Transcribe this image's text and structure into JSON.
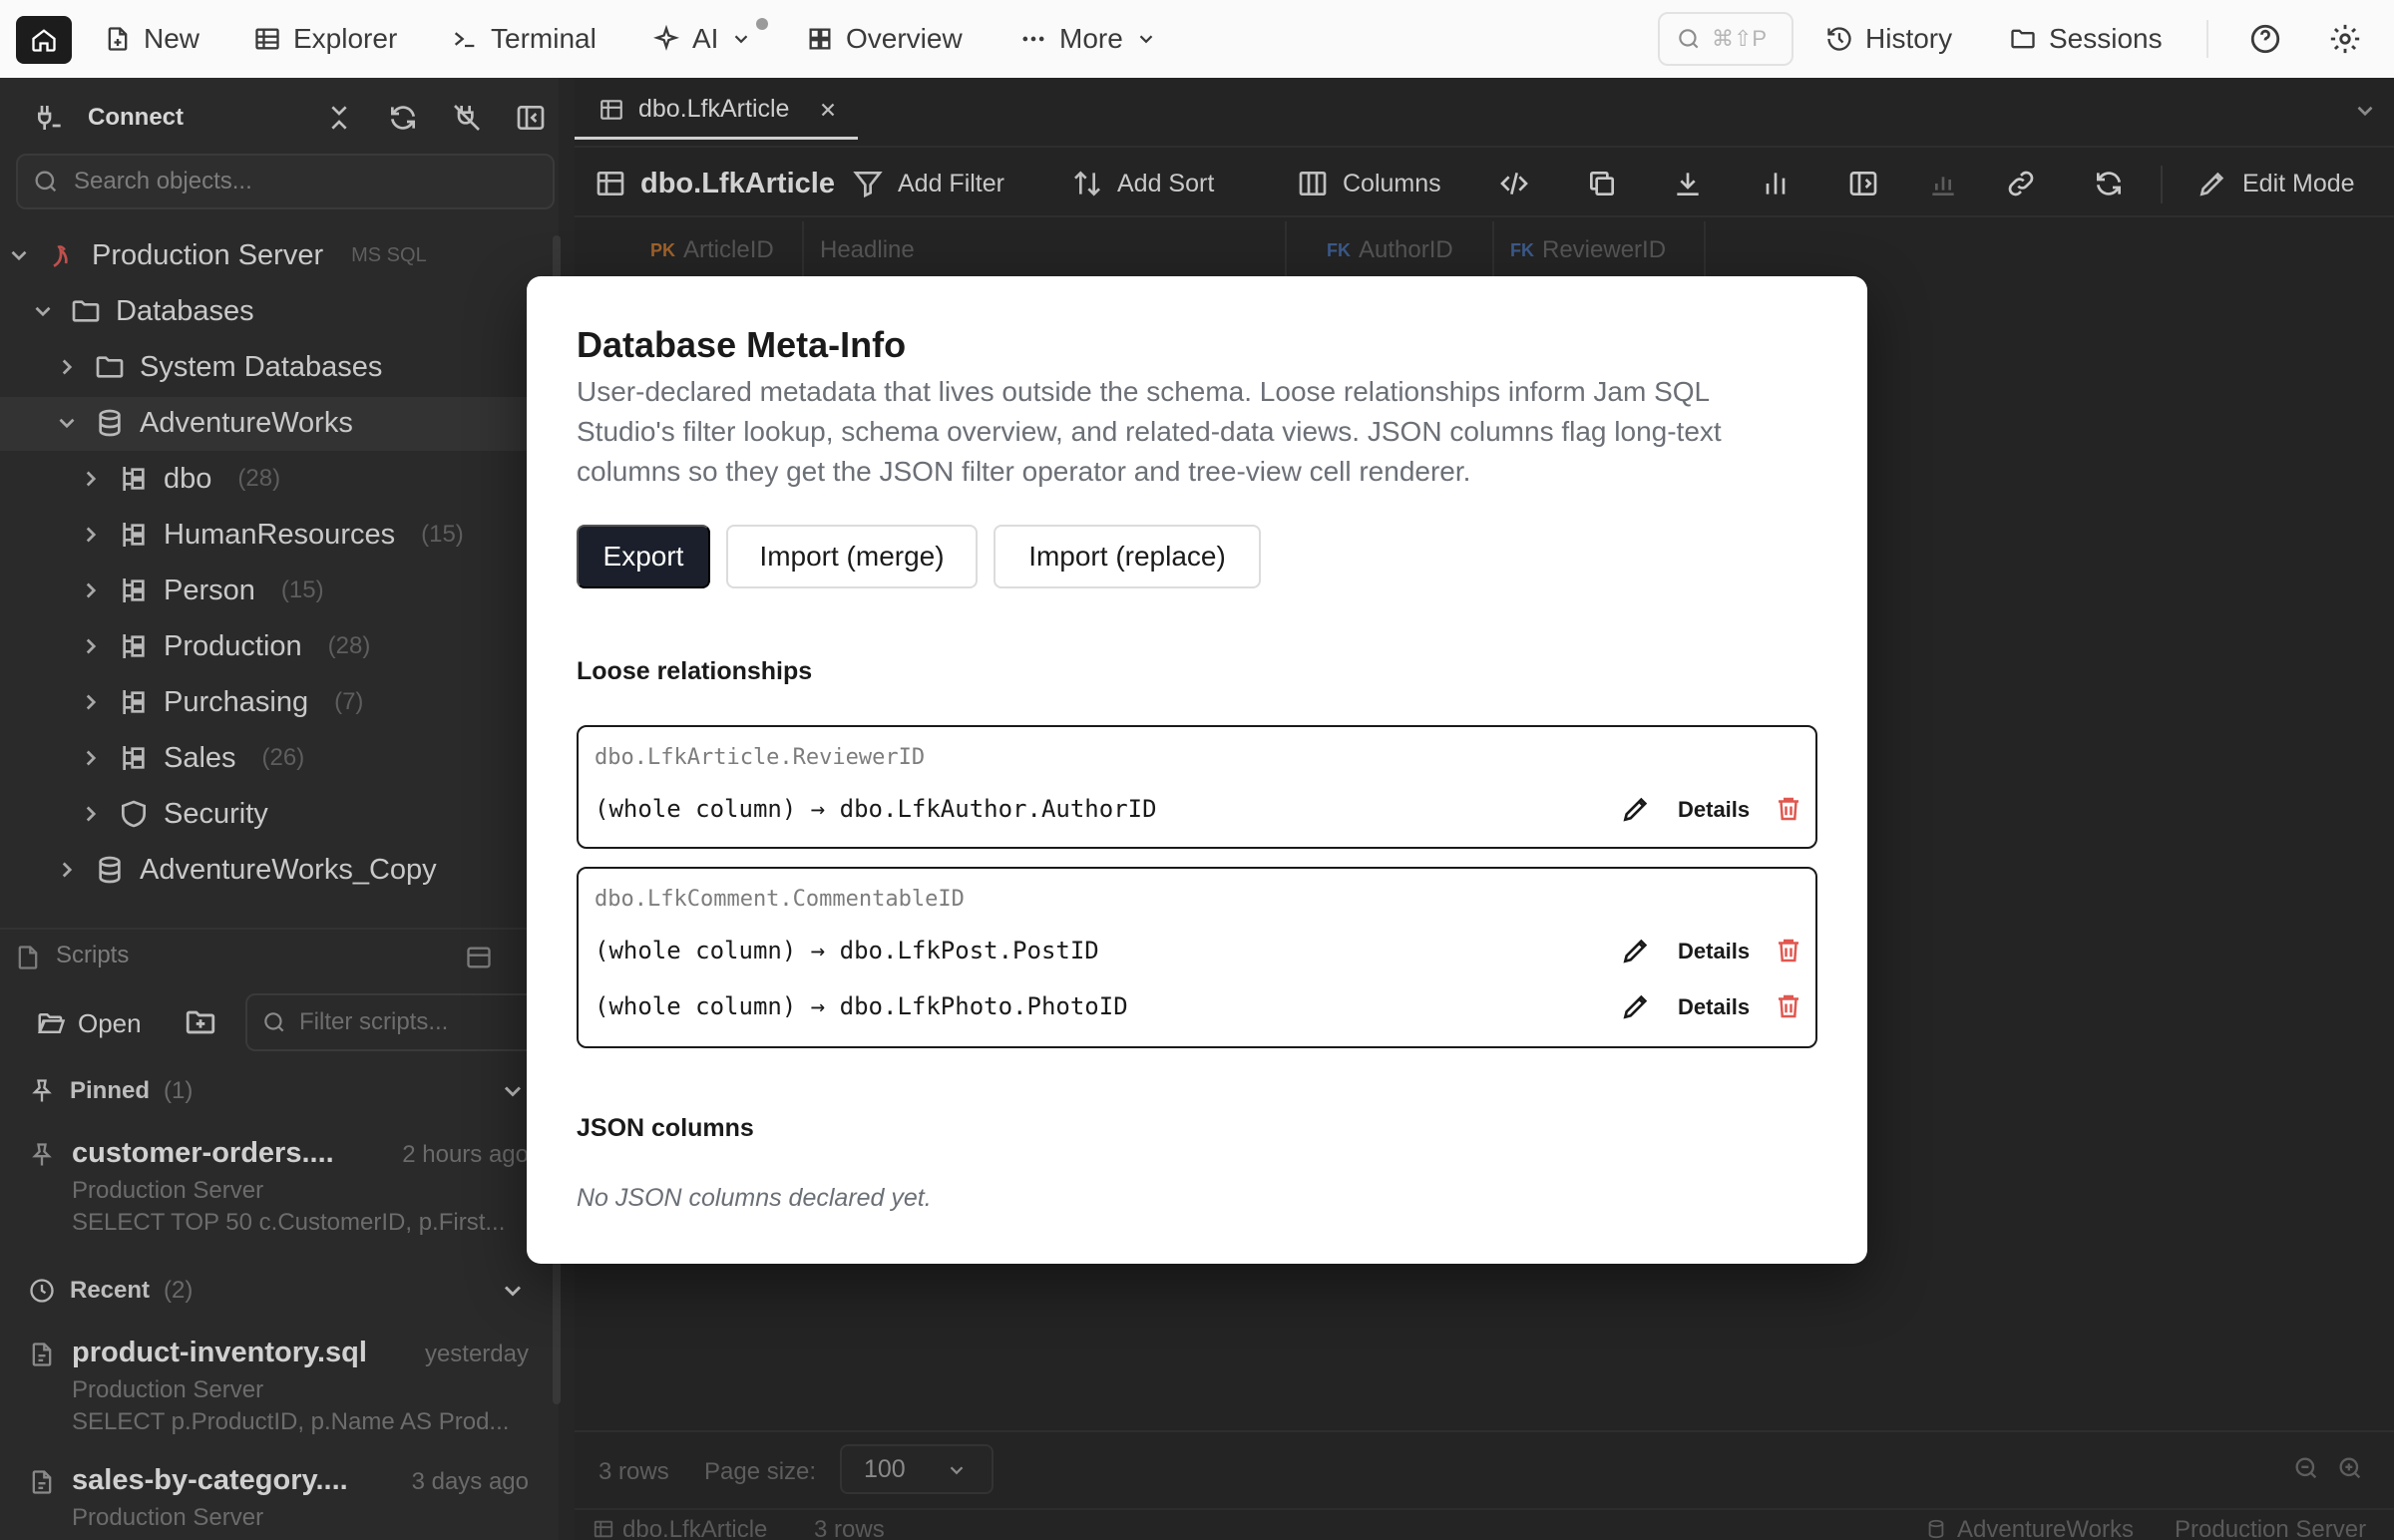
{
  "topbar": {
    "items": [
      {
        "label": "New",
        "icon": "file-plus-icon"
      },
      {
        "label": "Explorer",
        "icon": "table-icon"
      },
      {
        "label": "Terminal",
        "icon": "terminal-icon"
      },
      {
        "label": "AI",
        "icon": "sparkles-icon"
      },
      {
        "label": "Overview",
        "icon": "grid-icon"
      },
      {
        "label": "More",
        "icon": "dots-icon"
      }
    ],
    "search_shortcut": "⌘⇧P",
    "history_label": "History",
    "sessions_label": "Sessions"
  },
  "sidebar": {
    "connect_label": "Connect",
    "search_placeholder": "Search objects...",
    "server": {
      "name": "Production Server",
      "tag": "MS SQL"
    },
    "databases_label": "Databases",
    "system_db_label": "System Databases",
    "db_name": "AdventureWorks",
    "schemas": [
      {
        "name": "dbo",
        "count": "(28)"
      },
      {
        "name": "HumanResources",
        "count": "(15)"
      },
      {
        "name": "Person",
        "count": "(15)"
      },
      {
        "name": "Production",
        "count": "(28)"
      },
      {
        "name": "Purchasing",
        "count": "(7)"
      },
      {
        "name": "Sales",
        "count": "(26)"
      }
    ],
    "security_label": "Security",
    "db_copy_name": "AdventureWorks_Copy",
    "scripts": {
      "header": "Scripts",
      "open_label": "Open",
      "filter_placeholder": "Filter scripts...",
      "pinned": {
        "label": "Pinned",
        "count": "(1)"
      },
      "recent": {
        "label": "Recent",
        "count": "(2)"
      },
      "items": [
        {
          "name": "customer-orders....",
          "when": "2 hours ago",
          "server": "Production Server",
          "sql": "SELECT TOP 50 c.CustomerID, p.First..."
        },
        {
          "name": "product-inventory.sql",
          "when": "yesterday",
          "server": "Production Server",
          "sql": "SELECT p.ProductID, p.Name AS Prod..."
        },
        {
          "name": "sales-by-category....",
          "when": "3 days ago",
          "server": "Production Server",
          "sql": ""
        }
      ]
    }
  },
  "main": {
    "tab_label": "dbo.LfkArticle",
    "toolbar": {
      "title": "dbo.LfkArticle",
      "add_filter": "Add Filter",
      "add_sort": "Add Sort",
      "columns": "Columns",
      "edit_mode": "Edit Mode"
    },
    "grid_columns": [
      {
        "key": "PK",
        "name": "ArticleID",
        "key_color": "#a0622a"
      },
      {
        "key": "",
        "name": "Headline",
        "key_color": ""
      },
      {
        "key": "FK",
        "name": "AuthorID",
        "key_color": "#3c5a8a"
      },
      {
        "key": "FK",
        "name": "ReviewerID",
        "key_color": "#3c5a8a"
      }
    ],
    "footer": {
      "rows": "3 rows",
      "page_size_label": "Page size:",
      "page_size_value": "100"
    },
    "status": {
      "table": "dbo.LfkArticle",
      "rows": "3 rows",
      "database": "AdventureWorks",
      "server": "Production Server"
    }
  },
  "modal": {
    "title": "Database Meta-Info",
    "description": "User-declared metadata that lives outside the schema. Loose relationships inform Jam SQL Studio's filter lookup, schema overview, and related-data views. JSON columns flag long-text columns so they get the JSON filter operator and tree-view cell renderer.",
    "buttons": {
      "export": "Export",
      "import_merge": "Import (merge)",
      "import_replace": "Import (replace)"
    },
    "loose_relationships_label": "Loose relationships",
    "relationships": [
      {
        "source": "dbo.LfkArticle.ReviewerID",
        "targets": [
          {
            "scope": "(whole column)",
            "arrow": "→",
            "target": "dbo.LfkAuthor.AuthorID",
            "details_label": "Details"
          }
        ]
      },
      {
        "source": "dbo.LfkComment.CommentableID",
        "targets": [
          {
            "scope": "(whole column)",
            "arrow": "→",
            "target": "dbo.LfkPost.PostID",
            "details_label": "Details"
          },
          {
            "scope": "(whole column)",
            "arrow": "→",
            "target": "dbo.LfkPhoto.PhotoID",
            "details_label": "Details"
          }
        ]
      }
    ],
    "json_columns_label": "JSON columns",
    "json_empty": "No JSON columns declared yet."
  },
  "colors": {
    "accent_dark": "#1a1f2b",
    "delete_red": "#e0574f",
    "pk_key": "#a0622a",
    "fk_key": "#3c5a8a"
  }
}
